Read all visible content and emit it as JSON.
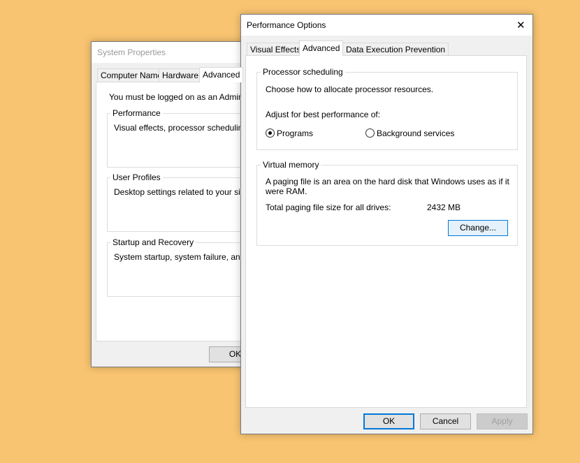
{
  "system_properties": {
    "title": "System Properties",
    "tabs": [
      "Computer Name",
      "Hardware",
      "Advanced"
    ],
    "admin_note": "You must be logged on as an Administrat",
    "groups": [
      {
        "label": "Performance",
        "text": "Visual effects, processor scheduling, m"
      },
      {
        "label": "User Profiles",
        "text": "Desktop settings related to your sign-in"
      },
      {
        "label": "Startup and Recovery",
        "text": "System startup, system failure, and deb"
      }
    ],
    "ok_label": "OK"
  },
  "performance_options": {
    "title": "Performance Options",
    "close_glyph": "✕",
    "tabs": [
      "Visual Effects",
      "Advanced",
      "Data Execution Prevention"
    ],
    "active_tab": "Advanced",
    "processor_scheduling": {
      "label": "Processor scheduling",
      "description": "Choose how to allocate processor resources.",
      "adjust_label": "Adjust for best performance of:",
      "options": [
        {
          "label": "Programs",
          "checked": true
        },
        {
          "label": "Background services",
          "checked": false
        }
      ]
    },
    "virtual_memory": {
      "label": "Virtual memory",
      "description_line1": "A paging file is an area on the hard disk that Windows uses as if it",
      "description_line2": "were RAM.",
      "total_label": "Total paging file size for all drives:",
      "total_value": "2432 MB",
      "change_label": "Change..."
    },
    "buttons": {
      "ok": "OK",
      "cancel": "Cancel",
      "apply": "Apply"
    }
  },
  "colors": {
    "desktop": "#F8C471",
    "accent": "#0078D7"
  }
}
